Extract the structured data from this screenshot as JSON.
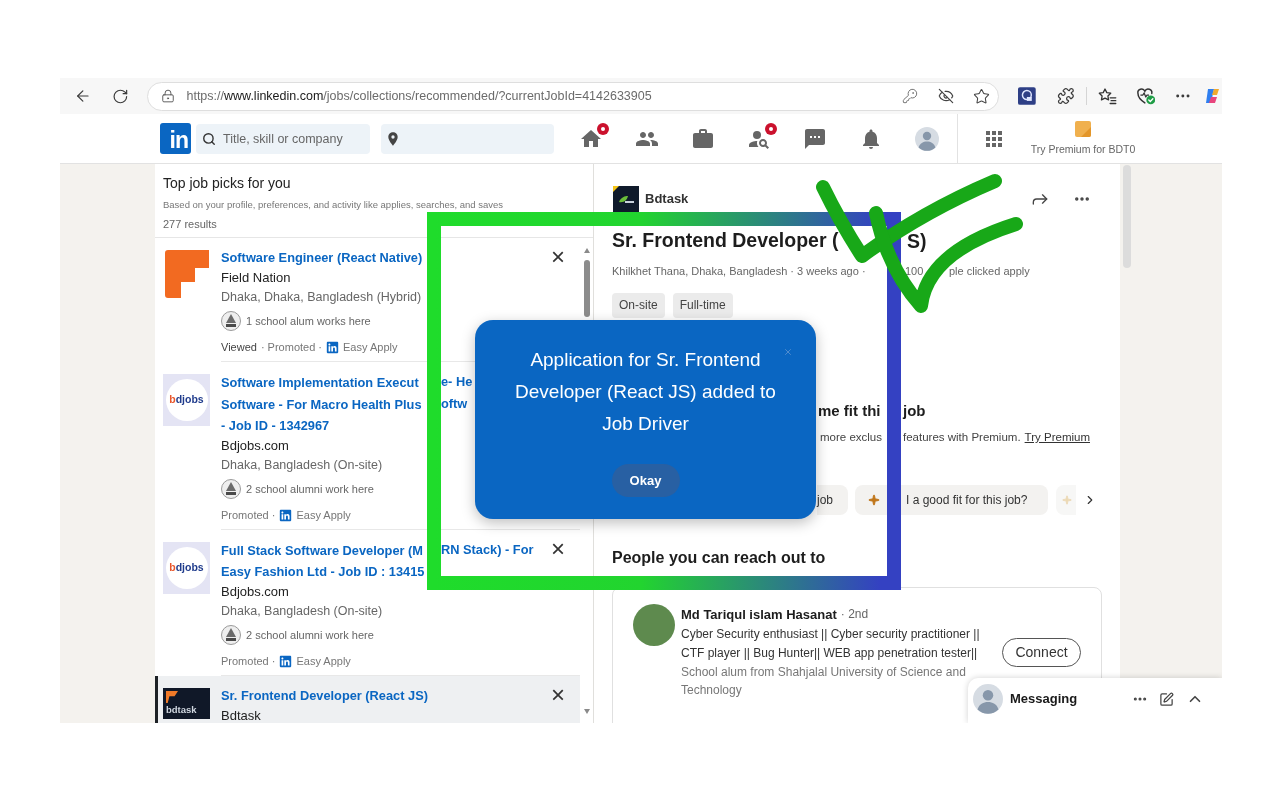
{
  "browser": {
    "url": {
      "scheme": "https://",
      "host": "www.linkedin.com",
      "path": "/jobs/collections/recommended/?currentJobId=4142633905"
    }
  },
  "nav": {
    "logo": "in",
    "search_placeholder": "Title, skill or company",
    "items": [
      {
        "kind": "home",
        "badge": true
      },
      {
        "kind": "network",
        "badge": false
      },
      {
        "kind": "jobs",
        "badge": false
      },
      {
        "kind": "people_search",
        "badge": true
      },
      {
        "kind": "messaging",
        "badge": false
      },
      {
        "kind": "notifications",
        "badge": false
      },
      {
        "kind": "profile",
        "badge": false
      }
    ],
    "premium": "Try Premium for BDT0"
  },
  "job_list": {
    "title": "Top job picks for you",
    "subtitle": "Based on your profile, preferences, and activity like applies, searches, and saves",
    "count": "277 results",
    "jobs": [
      {
        "logo": {
          "kind": "orange_blocks"
        },
        "title_lines": [
          [
            "Software Engineer (React Native)"
          ]
        ],
        "company": "Field Nation",
        "location": "Dhaka, Dhaka, Bangladesh (Hybrid)",
        "alumni": "1 school alum works here",
        "footer": [
          {
            "kind": "viewed",
            "text": "Viewed"
          },
          {
            "kind": "plain",
            "text": "· Promoted ·"
          },
          {
            "kind": "easy_apply",
            "text": "Easy Apply"
          }
        ],
        "close": "×",
        "selected": false
      },
      {
        "logo": {
          "kind": "bdjobs",
          "text": "bdjobs"
        },
        "title_lines": [
          [
            "Software Implementation Execut",
            "e- He"
          ],
          [
            "Software - For Macro Health Plus",
            "oftw"
          ],
          [
            "- Job ID - 1342967"
          ]
        ],
        "company": "Bdjobs.com",
        "location": "Dhaka, Bangladesh (On-site)",
        "alumni": "2 school alumni work here",
        "footer": [
          {
            "kind": "plain",
            "text": "Promoted ·"
          },
          {
            "kind": "easy_apply",
            "text": "Easy Apply"
          }
        ],
        "selected": false
      },
      {
        "logo": {
          "kind": "bdjobs",
          "text": "bdjobs"
        },
        "title_lines": [
          [
            "Full Stack Software Developer (M",
            "RN Stack) - For"
          ],
          [
            "Easy Fashion Ltd - Job ID : 13415"
          ]
        ],
        "company": "Bdjobs.com",
        "location": "Dhaka, Bangladesh (On-site)",
        "alumni": "2 school alumni work here",
        "footer": [
          {
            "kind": "plain",
            "text": "Promoted ·"
          },
          {
            "kind": "easy_apply",
            "text": "Easy Apply"
          }
        ],
        "close": "×",
        "selected": false
      },
      {
        "logo": {
          "kind": "bdtask",
          "text": "bdtask"
        },
        "title_lines": [
          [
            "Sr. Frontend Developer (React JS)"
          ]
        ],
        "company": "Bdtask",
        "close": "×",
        "selected": true
      }
    ]
  },
  "job_detail": {
    "company": "Bdtask",
    "title_parts": [
      "Sr. Frontend Developer (",
      "S)"
    ],
    "meta_parts": [
      "Khilkhet Thana, Dhaka, Bangladesh · 3 weeks ago ·",
      "100",
      "ple clicked apply"
    ],
    "tags": [
      "On-site",
      "Full-time"
    ],
    "premium": {
      "heading_parts": [
        "me fit thi",
        "job"
      ],
      "text_parts": [
        "more exclus",
        "features with Premium."
      ],
      "link": "Try Premium",
      "chips": [
        {
          "kind": "cut",
          "text": "job"
        },
        {
          "kind": "sparkle",
          "text": "I a good fit for this job?"
        },
        {
          "kind": "faded"
        }
      ]
    },
    "people": {
      "heading": "People you can reach out to",
      "person": {
        "name": "Md Tariqul islam Hasanat",
        "degree": "· 2nd",
        "headline": "Cyber Security enthusiast || Cyber security practitioner || CTF player || Bug Hunter|| WEB app penetration tester||",
        "school": "School alum from Shahjalal University of Science and Technology",
        "action": "Connect"
      }
    }
  },
  "modal": {
    "message": "Application for Sr. Frontend Developer (React JS) added to Job Driver",
    "button": "Okay"
  },
  "messaging": {
    "label": "Messaging"
  }
}
